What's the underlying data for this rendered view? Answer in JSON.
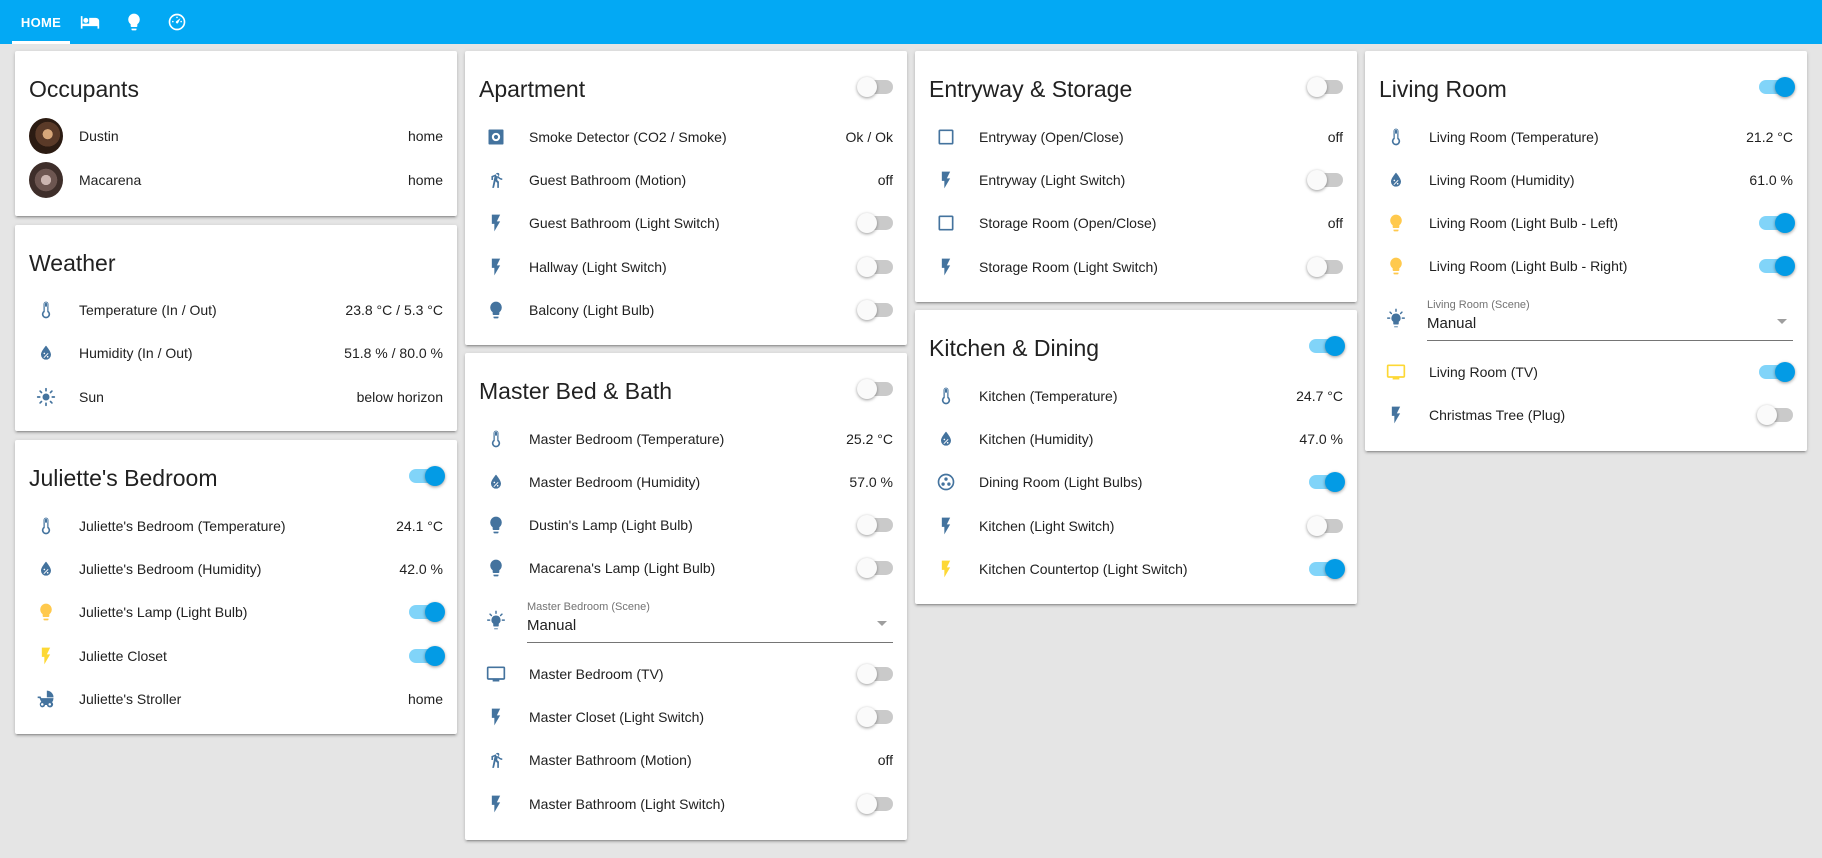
{
  "tabs": [
    {
      "label": "HOME",
      "active": true
    },
    {
      "icon": "bed-icon"
    },
    {
      "icon": "lightbulb-icon"
    },
    {
      "icon": "speedometer-icon"
    }
  ],
  "colors": {
    "header": "#03a9f4",
    "toggle_on": "#039be5",
    "icon_default": "#44739e",
    "icon_active": "#fdd835",
    "icon_bulb_on": "#ffc94d"
  },
  "occupants": {
    "title": "Occupants",
    "rows": [
      {
        "name": "Dustin",
        "state": "home"
      },
      {
        "name": "Macarena",
        "state": "home"
      }
    ]
  },
  "weather": {
    "title": "Weather",
    "rows": [
      {
        "name": "Temperature (In / Out)",
        "state": "23.8 °C / 5.3 °C",
        "icon": "thermometer-icon"
      },
      {
        "name": "Humidity (In / Out)",
        "state": "51.8 % / 80.0 %",
        "icon": "water-percent-icon"
      },
      {
        "name": "Sun",
        "state": "below horizon",
        "icon": "sun-icon"
      }
    ]
  },
  "juliette": {
    "title": "Juliette's Bedroom",
    "toggle": true,
    "rows": [
      {
        "name": "Juliette's Bedroom (Temperature)",
        "state": "24.1 °C",
        "icon": "thermometer-icon"
      },
      {
        "name": "Juliette's Bedroom (Humidity)",
        "state": "42.0 %",
        "icon": "water-percent-icon"
      },
      {
        "name": "Juliette's Lamp (Light Bulb)",
        "toggle": true,
        "icon": "lightbulb-icon"
      },
      {
        "name": "Juliette Closet",
        "toggle": true,
        "icon": "flash-icon"
      },
      {
        "name": "Juliette's Stroller",
        "state": "home",
        "icon": "baby-carriage-icon"
      }
    ]
  },
  "apartment": {
    "title": "Apartment",
    "toggle": false,
    "rows": [
      {
        "name": "Smoke Detector (CO2 / Smoke)",
        "state": "Ok / Ok",
        "icon": "smoke-detector-icon"
      },
      {
        "name": "Guest Bathroom (Motion)",
        "state": "off",
        "icon": "walk-icon"
      },
      {
        "name": "Guest Bathroom (Light Switch)",
        "toggle": false,
        "icon": "flash-icon"
      },
      {
        "name": "Hallway (Light Switch)",
        "toggle": false,
        "icon": "flash-icon"
      },
      {
        "name": "Balcony (Light Bulb)",
        "toggle": false,
        "icon": "lightbulb-icon"
      }
    ]
  },
  "master": {
    "title": "Master Bed & Bath",
    "toggle": false,
    "rows_top": [
      {
        "name": "Master Bedroom (Temperature)",
        "state": "25.2 °C",
        "icon": "thermometer-icon"
      },
      {
        "name": "Master Bedroom (Humidity)",
        "state": "57.0 %",
        "icon": "water-percent-icon"
      },
      {
        "name": "Dustin's Lamp (Light Bulb)",
        "toggle": false,
        "icon": "lightbulb-icon"
      },
      {
        "name": "Macarena's Lamp (Light Bulb)",
        "toggle": false,
        "icon": "lightbulb-icon"
      }
    ],
    "scene": {
      "label": "Master Bedroom (Scene)",
      "value": "Manual"
    },
    "rows_bottom": [
      {
        "name": "Master Bedroom (TV)",
        "toggle": false,
        "icon": "tv-icon"
      },
      {
        "name": "Master Closet (Light Switch)",
        "toggle": false,
        "icon": "flash-icon"
      },
      {
        "name": "Master Bathroom (Motion)",
        "state": "off",
        "icon": "walk-icon"
      },
      {
        "name": "Master Bathroom (Light Switch)",
        "toggle": false,
        "icon": "flash-icon"
      }
    ]
  },
  "entryway": {
    "title": "Entryway & Storage",
    "toggle": false,
    "rows": [
      {
        "name": "Entryway (Open/Close)",
        "state": "off",
        "icon": "checkbox-blank-icon"
      },
      {
        "name": "Entryway (Light Switch)",
        "toggle": false,
        "icon": "flash-icon"
      },
      {
        "name": "Storage Room (Open/Close)",
        "state": "off",
        "icon": "checkbox-blank-icon"
      },
      {
        "name": "Storage Room (Light Switch)",
        "toggle": false,
        "icon": "flash-icon"
      }
    ]
  },
  "kitchen": {
    "title": "Kitchen & Dining",
    "toggle": true,
    "rows": [
      {
        "name": "Kitchen (Temperature)",
        "state": "24.7 °C",
        "icon": "thermometer-icon"
      },
      {
        "name": "Kitchen (Humidity)",
        "state": "47.0 %",
        "icon": "water-percent-icon"
      },
      {
        "name": "Dining Room (Light Bulbs)",
        "toggle": true,
        "icon": "ceiling-light-icon"
      },
      {
        "name": "Kitchen (Light Switch)",
        "toggle": false,
        "icon": "flash-icon"
      },
      {
        "name": "Kitchen Countertop (Light Switch)",
        "toggle": true,
        "icon": "flash-icon"
      }
    ]
  },
  "living": {
    "title": "Living Room",
    "toggle": true,
    "rows_top": [
      {
        "name": "Living Room (Temperature)",
        "state": "21.2 °C",
        "icon": "thermometer-icon"
      },
      {
        "name": "Living Room (Humidity)",
        "state": "61.0 %",
        "icon": "water-percent-icon"
      },
      {
        "name": "Living Room (Light Bulb - Left)",
        "toggle": true,
        "icon": "lightbulb-icon"
      },
      {
        "name": "Living Room (Light Bulb - Right)",
        "toggle": true,
        "icon": "lightbulb-icon"
      }
    ],
    "scene": {
      "label": "Living Room (Scene)",
      "value": "Manual"
    },
    "rows_bottom": [
      {
        "name": "Living Room (TV)",
        "toggle": true,
        "icon": "tv-icon"
      },
      {
        "name": "Christmas Tree (Plug)",
        "toggle": false,
        "icon": "flash-icon"
      }
    ]
  }
}
